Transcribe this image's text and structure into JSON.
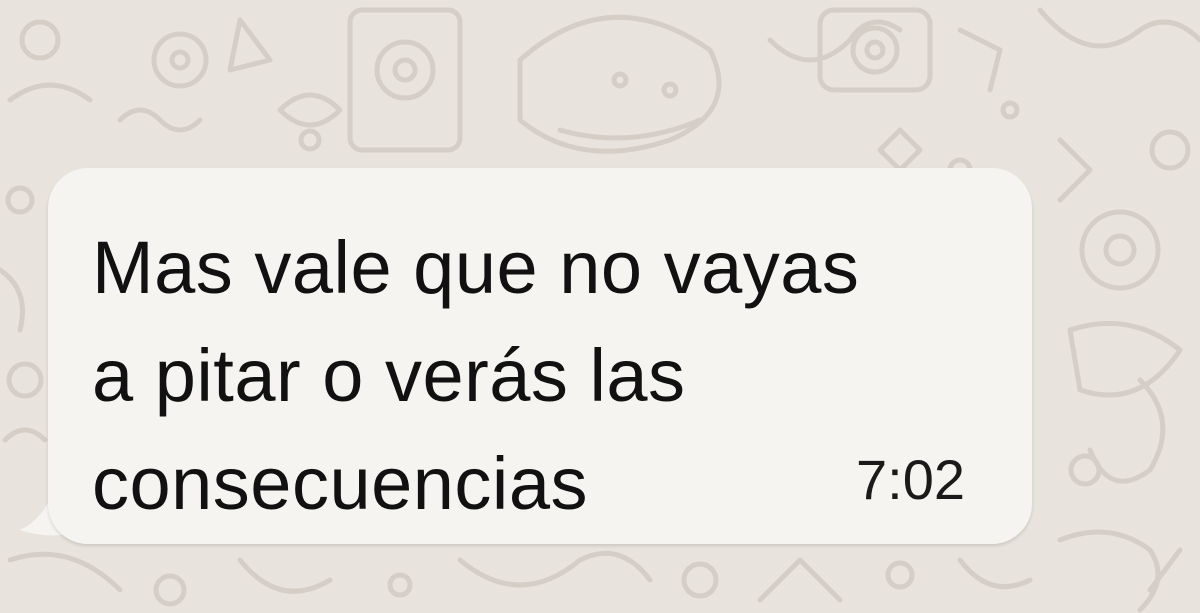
{
  "chat": {
    "message": {
      "lines": [
        "Mas vale que no vayas",
        "a pitar o verás las",
        "consecuencias"
      ],
      "time": "7:02"
    }
  },
  "colors": {
    "wallpaper": "#e8e3dc",
    "doodle": "#d4cec6",
    "bubble": "#f5f4f1",
    "text": "#111111"
  },
  "icons": [
    "doodle-pattern",
    "camera-icon",
    "chat-tail"
  ]
}
